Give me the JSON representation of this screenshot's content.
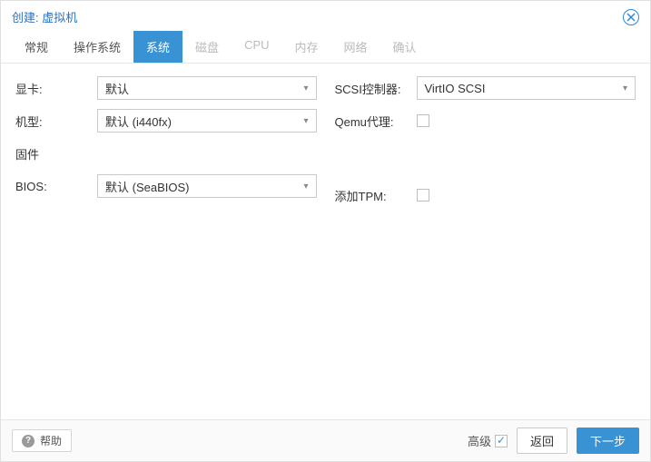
{
  "header": {
    "title": "创建: 虚拟机"
  },
  "tabs": [
    {
      "label": "常规",
      "state": "enabled"
    },
    {
      "label": "操作系统",
      "state": "enabled"
    },
    {
      "label": "系统",
      "state": "active"
    },
    {
      "label": "磁盘",
      "state": "disabled"
    },
    {
      "label": "CPU",
      "state": "disabled"
    },
    {
      "label": "内存",
      "state": "disabled"
    },
    {
      "label": "网络",
      "state": "disabled"
    },
    {
      "label": "确认",
      "state": "disabled"
    }
  ],
  "left": {
    "graphics_label": "显卡:",
    "graphics_value": "默认",
    "machine_label": "机型:",
    "machine_value": "默认 (i440fx)",
    "firmware_label": "固件",
    "bios_label": "BIOS:",
    "bios_value": "默认 (SeaBIOS)"
  },
  "right": {
    "scsi_label": "SCSI控制器:",
    "scsi_value": "VirtIO SCSI",
    "qemu_label": "Qemu代理:",
    "qemu_checked": false,
    "tpm_label": "添加TPM:",
    "tpm_checked": false
  },
  "footer": {
    "help": "帮助",
    "advanced": "高级",
    "advanced_checked": true,
    "back": "返回",
    "next": "下一步"
  }
}
